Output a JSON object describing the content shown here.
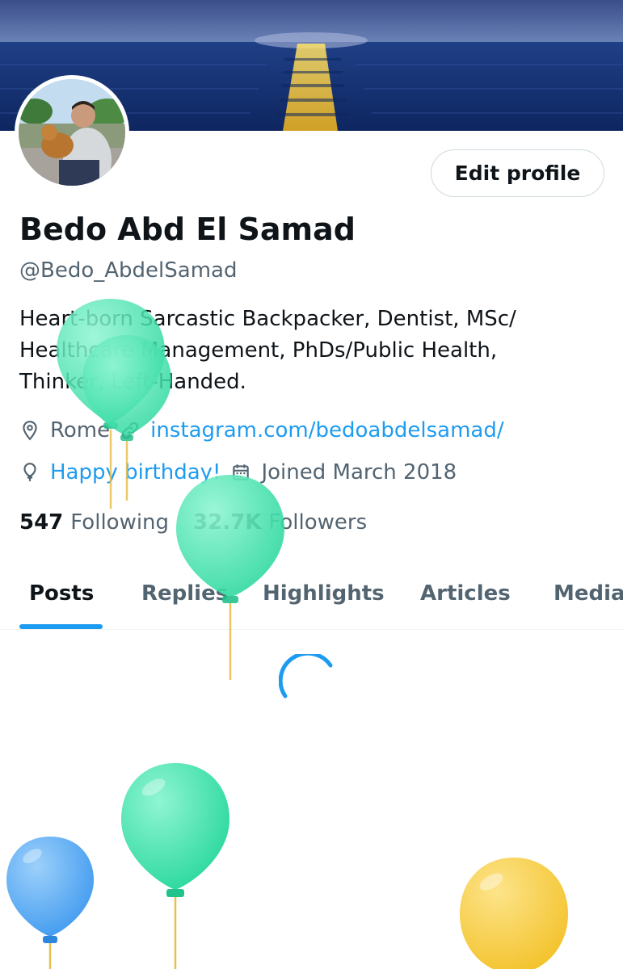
{
  "profile": {
    "display_name": "Bedo Abd El Samad",
    "handle": "@Bedo_AbdelSamad",
    "bio": "Heart-born Sarcastic Backpacker, Dentist, MSc/ Healthcare Management, PhDs/Public Health, Thinker, Left-Handed.",
    "location": "Rome",
    "website": "instagram.com/bedoabdelsamad/",
    "birthday": "Happy birthday!",
    "joined": "Joined March 2018",
    "following_count": "547",
    "following_label": "Following",
    "followers_count": "32.7K",
    "followers_label": "Followers",
    "edit_profile_label": "Edit profile"
  },
  "tabs": [
    {
      "label": "Posts",
      "active": true
    },
    {
      "label": "Replies",
      "active": false
    },
    {
      "label": "Highlights",
      "active": false
    },
    {
      "label": "Articles",
      "active": false
    },
    {
      "label": "Media",
      "active": false
    }
  ],
  "icons": {
    "location": "location-pin-icon",
    "link": "link-icon",
    "birthday": "balloon-icon",
    "joined": "calendar-icon"
  },
  "colors": {
    "accent": "#1d9bf0",
    "text_primary": "#0f1419",
    "text_secondary": "#536471",
    "balloon_green": "#3ee8b0",
    "balloon_blue": "#4ea8f5",
    "balloon_yellow": "#f8cf40"
  }
}
